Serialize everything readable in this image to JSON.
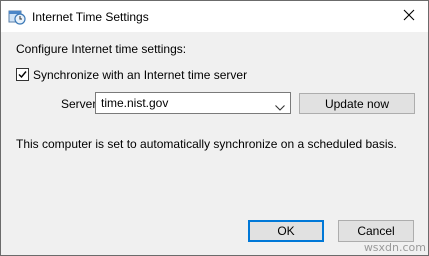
{
  "window": {
    "title": "Internet Time Settings"
  },
  "main": {
    "config_label": "Configure Internet time settings:",
    "sync_checkbox": {
      "label": "Synchronize with an Internet time server",
      "checked": true
    },
    "server": {
      "label": "Server:",
      "value": "time.nist.gov"
    },
    "update_button": "Update now",
    "status_text": "This computer is set to automatically synchronize on a scheduled basis."
  },
  "footer": {
    "ok_label": "OK",
    "cancel_label": "Cancel"
  },
  "watermark": "wsxdn.com",
  "colors": {
    "focus_border": "#0078d7",
    "dialog_bg": "#f0f0f0",
    "button_bg": "#e1e1e1"
  }
}
